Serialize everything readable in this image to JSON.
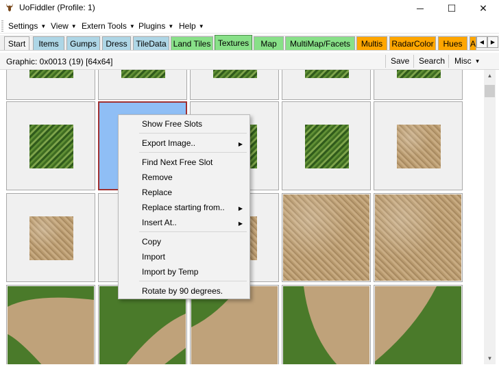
{
  "window": {
    "title": "UoFiddler (Profile: 1)",
    "controls": {
      "minimize": "─",
      "maximize": "☐",
      "close": "✕"
    }
  },
  "menubar": {
    "items": [
      "Settings",
      "View",
      "Extern Tools",
      "Plugins",
      "Help"
    ],
    "caret": "▼"
  },
  "tabs": [
    {
      "label": "Start",
      "color": "#f3f3f3"
    },
    {
      "label": "Items",
      "color": "#aed6e6"
    },
    {
      "label": "Gumps",
      "color": "#aed6e6"
    },
    {
      "label": "Dress",
      "color": "#aed6e6"
    },
    {
      "label": "TileData",
      "color": "#aed6e6"
    },
    {
      "label": "Land Tiles",
      "color": "#88e088"
    },
    {
      "label": "Textures",
      "color": "#88e088",
      "selected": true
    },
    {
      "label": "Map",
      "color": "#88e088"
    },
    {
      "label": "MultiMap/Facets",
      "color": "#88e088"
    },
    {
      "label": "Multis",
      "color": "#ffa600"
    },
    {
      "label": "RadarColor",
      "color": "#ffa600"
    },
    {
      "label": "Hues",
      "color": "#ffa600"
    },
    {
      "label": "A",
      "color": "#ffa600"
    }
  ],
  "tab_scroll": {
    "left": "◀",
    "right": "▶"
  },
  "toolbar": {
    "graphic_info": "Graphic: 0x0013 (19) [64x64]",
    "save": "Save",
    "search": "Search",
    "misc": "Misc",
    "caret": "▼"
  },
  "context_menu": {
    "items": [
      {
        "label": "Show Free Slots"
      },
      {
        "label": "Export Image..",
        "submenu": true
      },
      {
        "label": "Find Next Free Slot"
      },
      {
        "label": "Remove"
      },
      {
        "label": "Replace"
      },
      {
        "label": "Replace starting from..",
        "submenu": true
      },
      {
        "label": "Insert At..",
        "submenu": true
      },
      {
        "label": "Copy"
      },
      {
        "label": "Import"
      },
      {
        "label": "Import by Temp"
      },
      {
        "label": "Rotate by 90 degrees."
      }
    ],
    "submenu_arrow": "▶"
  },
  "scrollbar": {
    "up": "▲",
    "down": "▼"
  },
  "icons": {
    "app": "deer-head-icon",
    "tab_scroll_left": "triangle-left-icon",
    "tab_scroll_right": "triangle-right-icon"
  }
}
